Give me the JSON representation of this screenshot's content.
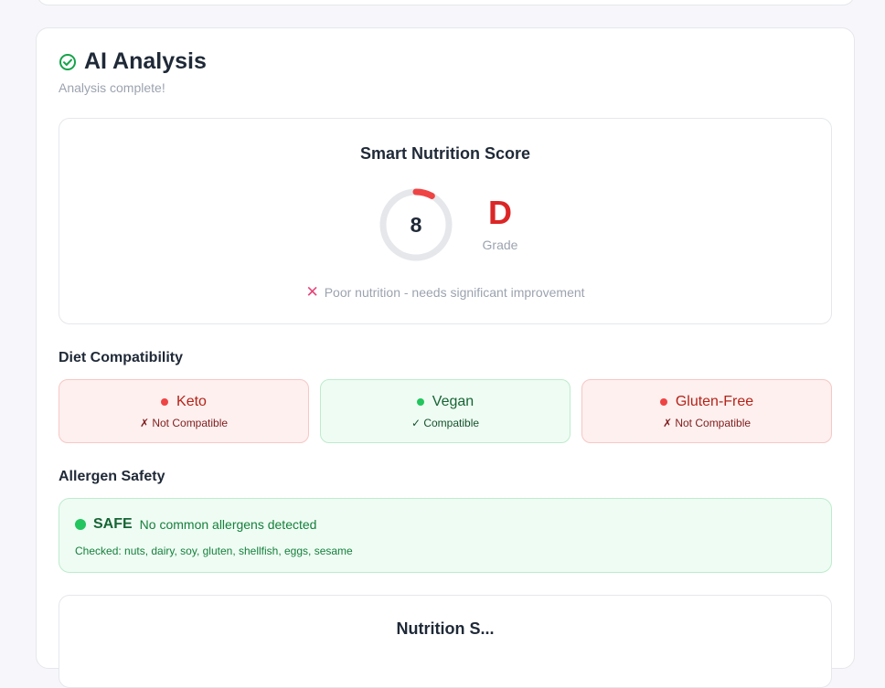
{
  "analysis": {
    "title": "AI Analysis",
    "subtitle": "Analysis complete!"
  },
  "score": {
    "title": "Smart Nutrition Score",
    "value": "8",
    "max": 100,
    "grade": "D",
    "grade_label": "Grade",
    "message": "Poor nutrition - needs significant improvement",
    "accent_color": "#ef4444",
    "grade_color": "#dc2626"
  },
  "diet": {
    "title": "Diet Compatibility",
    "items": [
      {
        "name": "Keto",
        "status": "✗ Not Compatible",
        "compatible": false
      },
      {
        "name": "Vegan",
        "status": "✓ Compatible",
        "compatible": true
      },
      {
        "name": "Gluten-Free",
        "status": "✗ Not Compatible",
        "compatible": false
      }
    ]
  },
  "allergen": {
    "title": "Allergen Safety",
    "status": "SAFE",
    "message": "No common allergens detected",
    "checked": "Checked: nuts, dairy, soy, gluten, shellfish, eggs, sesame"
  },
  "next_section": {
    "title": "Nutrition S..."
  },
  "icons": {
    "header": "check-circle-icon",
    "message": "cross-mark-icon"
  }
}
